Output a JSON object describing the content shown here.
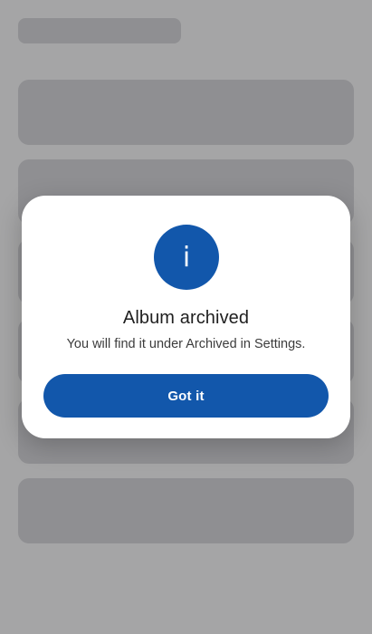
{
  "dialog": {
    "icon": "info-icon",
    "icon_glyph": "i",
    "title": "Album archived",
    "message": "You will find it under Archived in Settings.",
    "button_label": "Got it"
  },
  "colors": {
    "accent": "#1257ab",
    "scrim": "#8a8b8e",
    "skeleton": "#d9dadc",
    "dialog_bg": "#ffffff"
  }
}
